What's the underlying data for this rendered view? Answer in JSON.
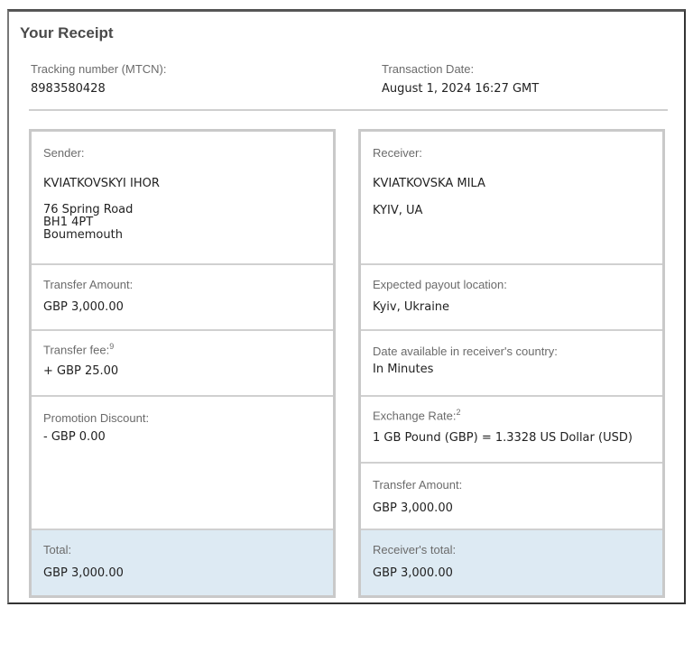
{
  "title": "Your Receipt",
  "tracking": {
    "label": "Tracking number (MTCN):",
    "value": "8983580428"
  },
  "transaction_date": {
    "label": "Transaction Date:",
    "value": "August 1, 2024 16:27 GMT"
  },
  "sender": {
    "label": "Sender:",
    "name": "KVIATKOVSKYI IHOR",
    "address_line1": "76 Spring Road",
    "address_line2": "BH1 4PT",
    "address_line3": "Boumemouth",
    "transfer_amount_label": "Transfer Amount:",
    "transfer_amount": "GBP 3,000.00",
    "fee_label": "Transfer fee:",
    "fee_sup": "9",
    "fee_value": "+ GBP 25.00",
    "discount_label": "Promotion Discount:",
    "discount_value": "- GBP 0.00",
    "total_label": "Total:",
    "total_value": "GBP 3,000.00"
  },
  "receiver": {
    "label": "Receiver:",
    "name": "KVIATKOVSKA MILA",
    "location": "KYIV, UA",
    "payout_label": "Expected payout location:",
    "payout_value": "Kyiv, Ukraine",
    "available_label": "Date available in receiver's country:",
    "available_value": "In Minutes",
    "rate_label": "Exchange Rate:",
    "rate_sup": "2",
    "rate_value": "1 GB Pound (GBP) = 1.3328 US Dollar (USD)",
    "transfer_amount_label": "Transfer Amount:",
    "transfer_amount": "GBP 3,000.00",
    "total_label": "Receiver's total:",
    "total_value": "GBP 3,000.00"
  }
}
